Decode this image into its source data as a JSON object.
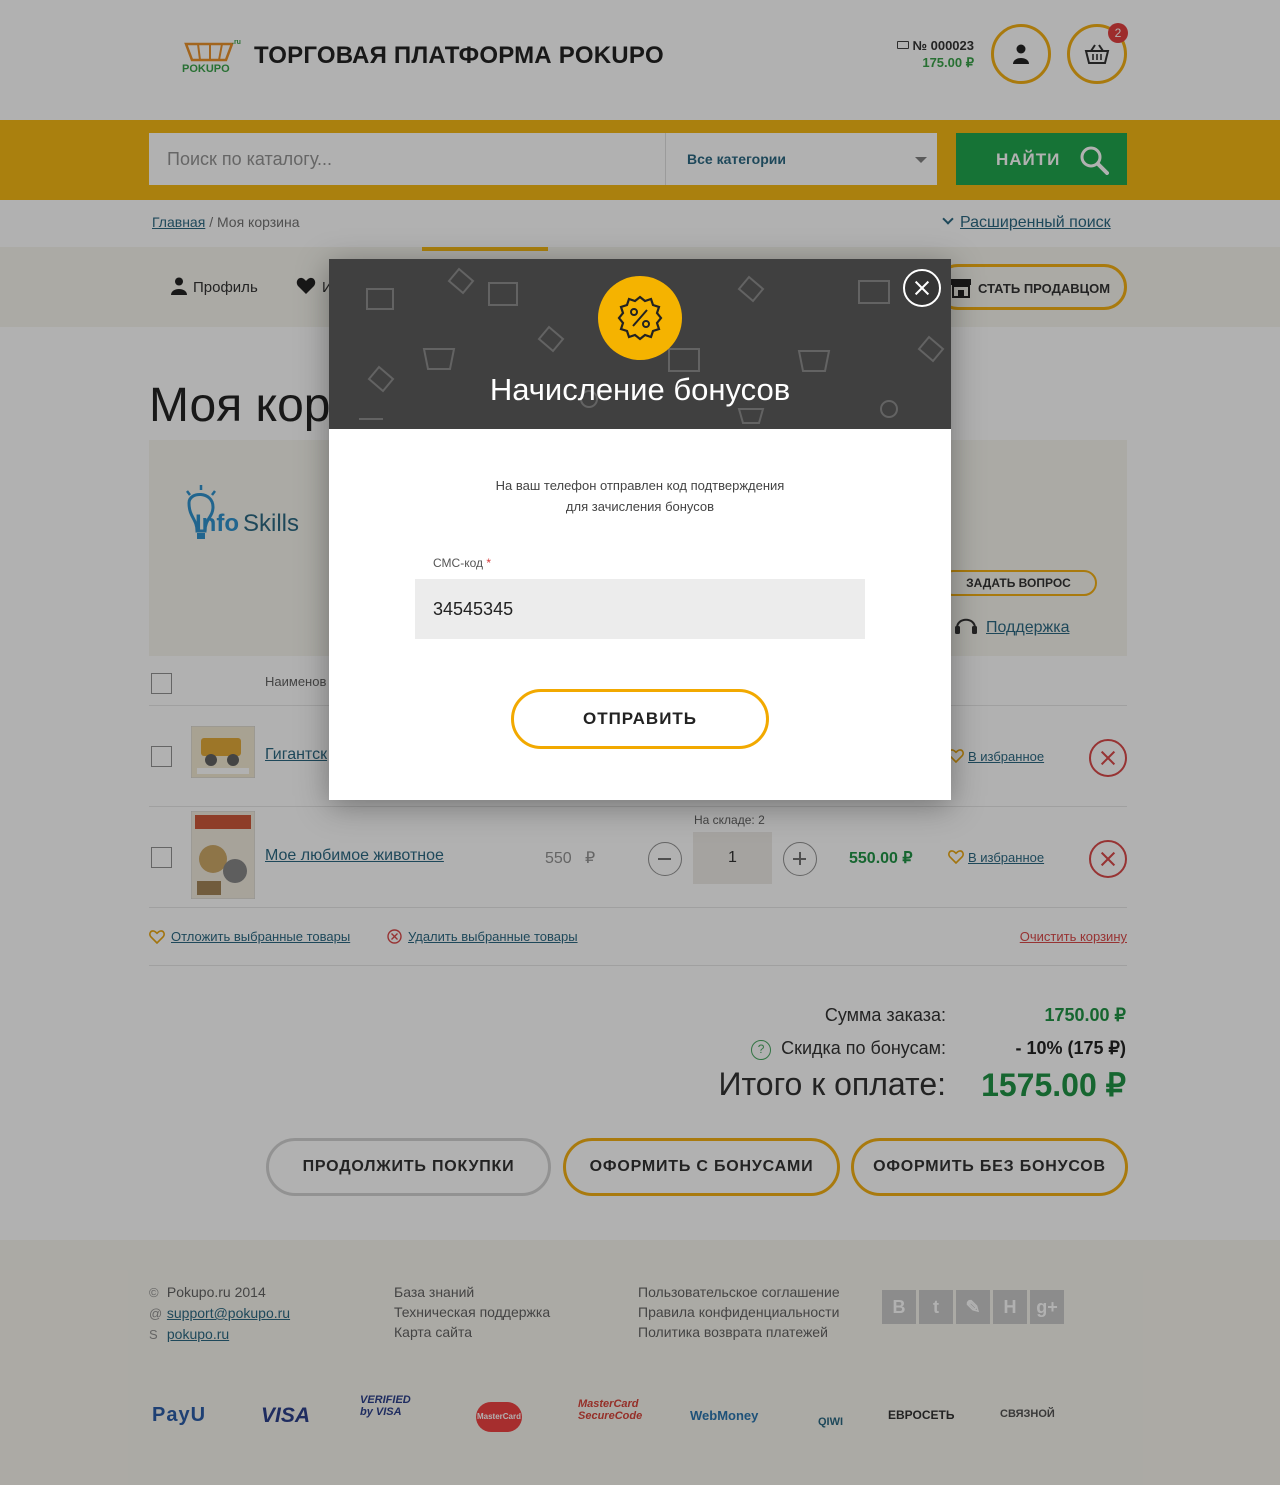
{
  "header": {
    "site_title": "ТОРГОВАЯ ПЛАТФОРМА POKUPO",
    "logo_text": "POKUPO.RU",
    "order_number": "№ 000023",
    "order_sum": "175.00 ₽",
    "cart_count": "2",
    "user_icon": "user-icon",
    "cart_icon": "basket-icon"
  },
  "search": {
    "placeholder": "Поиск по каталогу...",
    "category": "Все категории",
    "button_label": "НАЙТИ"
  },
  "breadcrumb": {
    "home": "Главная",
    "separator": "/",
    "current": "Моя корзина",
    "advanced_search": "Расширенный поиск"
  },
  "profile_tabs": {
    "profile": "Профиль",
    "favorites": "И",
    "become_seller": "СТАТЬ ПРОДАВЦОМ"
  },
  "page": {
    "title": "Моя корз"
  },
  "seller": {
    "logo_text_a": "Info",
    "logo_text_b": "Skills",
    "ask_question": "ЗАДАТЬ ВОПРОС",
    "support": "Поддержка"
  },
  "cart_table": {
    "header_name": "Наименов",
    "rows": [
      {
        "name": "Гигантск",
        "favorite": "В избранное"
      },
      {
        "name": "Мое любимое животное",
        "price": "550",
        "currency": "₽",
        "stock": "На складе: 2",
        "quantity": "1",
        "total": "550.00 ₽",
        "favorite": "В избранное"
      }
    ]
  },
  "bulk": {
    "defer": "Отложить выбранные товары",
    "delete": "Удалить выбранные товары",
    "clear": "Очистить корзину"
  },
  "summary": {
    "order_sum_label": "Сумма заказа:",
    "order_sum": "1750.00 ₽",
    "bonus_discount_label": "Скидка по бонусам:",
    "bonus_discount": "- 10% (175 ₽)",
    "total_label": "Итого к оплате:",
    "total": "1575.00 ₽"
  },
  "actions": {
    "continue": "ПРОДОЛЖИТЬ ПОКУПКИ",
    "checkout_with_bonus": "ОФОРМИТЬ С БОНУСАМИ",
    "checkout_without_bonus": "ОФОРМИТЬ БЕЗ БОНУСОВ"
  },
  "footer": {
    "copyright": "Pokupo.ru 2014",
    "email": "support@pokupo.ru",
    "skype": "pokupo.ru",
    "col2": [
      "База знаний",
      "Техническая поддержка",
      "Карта сайта"
    ],
    "col3": [
      "Пользовательское соглашение",
      "Правила конфиденциальности",
      "Политика возврата платежей"
    ],
    "socials": [
      "В",
      "t",
      "✎",
      "Н",
      "g+"
    ],
    "payments": [
      "PayU",
      "VISA",
      "VERIFIED by VISA",
      "MasterCard",
      "MasterCard SecureCode",
      "WebMoney",
      "QIWI",
      "ЕВРОСЕТЬ",
      "СВЯЗНОЙ"
    ]
  },
  "modal": {
    "title": "Начисление бонусов",
    "message_line1": "На ваш телефон отправлен код подтверждения",
    "message_line2": "для зачисления бонусов",
    "sms_label": "СМС-код",
    "required_mark": "*",
    "sms_value": "34545345",
    "submit": "ОТПРАВИТЬ",
    "badge_icon": "percent-badge-icon",
    "close_icon": "close-icon"
  },
  "colors": {
    "accent": "#f5b300",
    "green": "#0e9f3f",
    "link": "#1a5c78",
    "danger": "#d63a3a"
  }
}
